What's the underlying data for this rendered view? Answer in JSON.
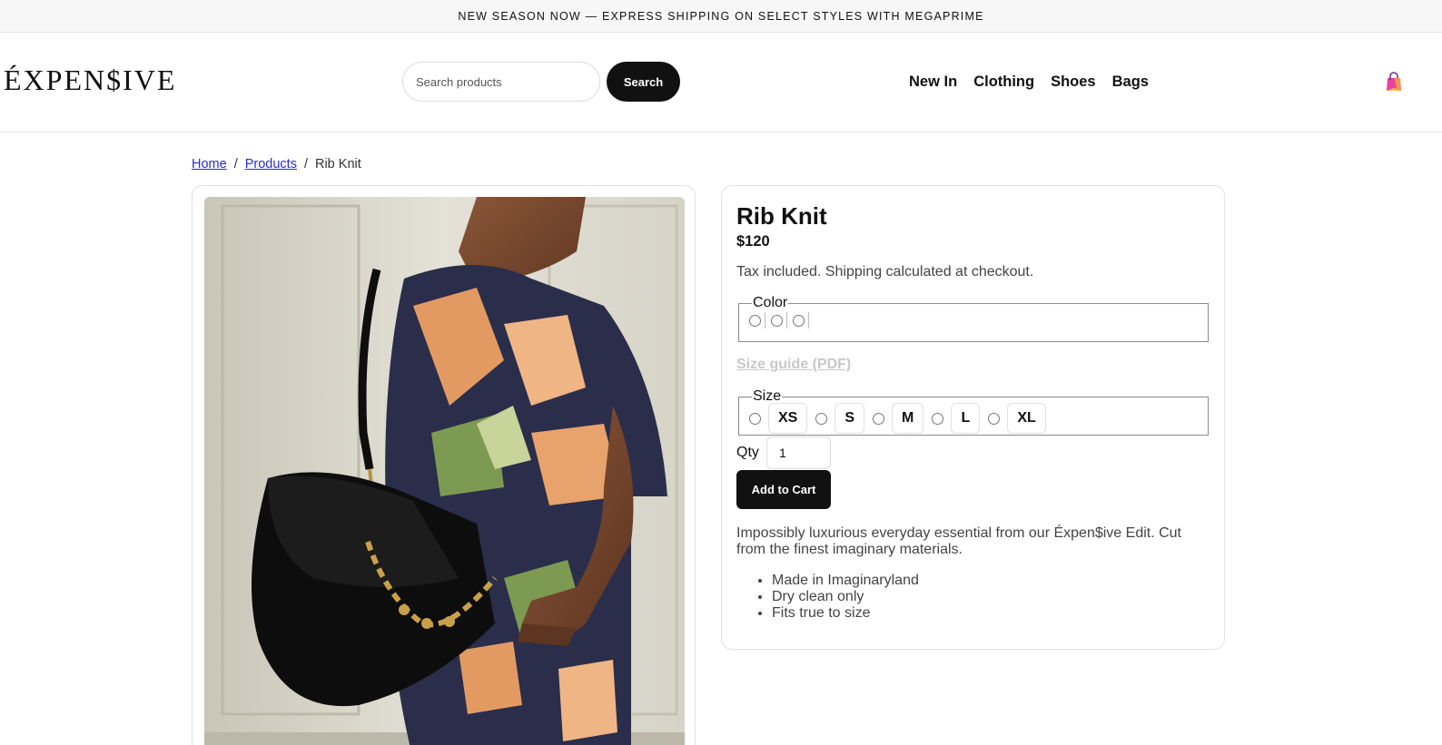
{
  "announcement": "NEW SEASON NOW — EXPRESS SHIPPING ON SELECT STYLES WITH MEGAPRIME",
  "header": {
    "logo": "ÉXPEN$IVE",
    "search": {
      "placeholder": "Search products",
      "value": "",
      "button_label": "Search"
    },
    "nav": [
      "New In",
      "Clothing",
      "Shoes",
      "Bags"
    ],
    "cart_icon": "shopping-bag-icon"
  },
  "breadcrumb": {
    "home": "Home",
    "products": "Products",
    "current": "Rib Knit",
    "separator": "/"
  },
  "product": {
    "title": "Rib Knit",
    "price": "$120",
    "tax_note": "Tax included. Shipping calculated at checkout.",
    "color_legend": "Color",
    "color_options": 3,
    "size_guide": "Size guide (PDF)",
    "size_legend": "Size",
    "sizes": [
      "XS",
      "S",
      "M",
      "L",
      "XL"
    ],
    "qty_label": "Qty",
    "qty_value": "1",
    "add_to_cart": "Add to Cart",
    "description": "Impossibly luxurious everyday essential from our Éxpen$ive Edit. Cut from the finest imaginary materials.",
    "features": [
      "Made in Imaginaryland",
      "Dry clean only",
      "Fits true to size"
    ]
  },
  "colors": {
    "accent": "#111111",
    "link": "#2b2bd6",
    "muted_text": "#444444",
    "disabled_link": "#c8c8c8"
  }
}
